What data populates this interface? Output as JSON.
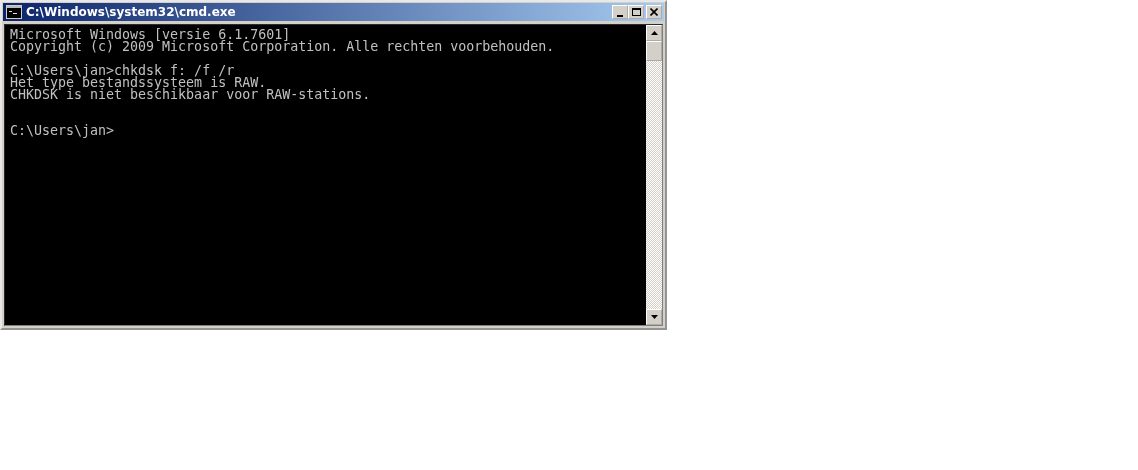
{
  "window": {
    "title": "C:\\Windows\\system32\\cmd.exe",
    "buttons": [
      {
        "kind": "minimize"
      },
      {
        "kind": "maximize"
      },
      {
        "kind": "close"
      }
    ]
  },
  "console": {
    "lines": [
      {
        "kind": "text",
        "text": "Microsoft Windows [versie 6.1.7601]"
      },
      {
        "kind": "text",
        "text": "Copyright (c) 2009 Microsoft Corporation. Alle rechten voorbehouden."
      },
      {
        "kind": "blank"
      },
      {
        "kind": "text",
        "text": "C:\\Users\\jan>chkdsk f: /f /r"
      },
      {
        "kind": "text",
        "text": "Het type bestandssysteem is RAW."
      },
      {
        "kind": "text",
        "text": "CHKDSK is niet beschikbaar voor RAW-stations."
      },
      {
        "kind": "blank"
      },
      {
        "kind": "blank"
      },
      {
        "kind": "text",
        "text": "C:\\Users\\jan>"
      }
    ]
  }
}
